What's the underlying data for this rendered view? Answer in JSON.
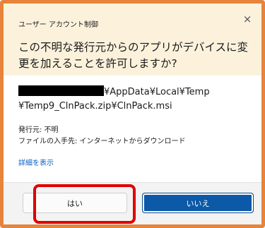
{
  "dialog": {
    "app_title": "ユーザー アカウント制御",
    "question": "この不明な発行元からのアプリがデバイスに変更を加えることを許可しますか?",
    "close_glyph": "×"
  },
  "content": {
    "path_line1_suffix": "¥AppData¥Local¥Temp",
    "path_line2": "¥Temp9_ClnPack.zip¥ClnPack.msi",
    "publisher": "発行元: 不明",
    "origin": "ファイルの入手先: インターネットからダウンロード",
    "details_link": "詳細を表示"
  },
  "buttons": {
    "yes": "はい",
    "no": "いいえ"
  },
  "colors": {
    "frame_accent": "#e6843c",
    "header_bg": "#fcf2dc",
    "primary_button": "#0c59a8",
    "annotation_red": "#e00000",
    "link": "#0a5fc2"
  }
}
